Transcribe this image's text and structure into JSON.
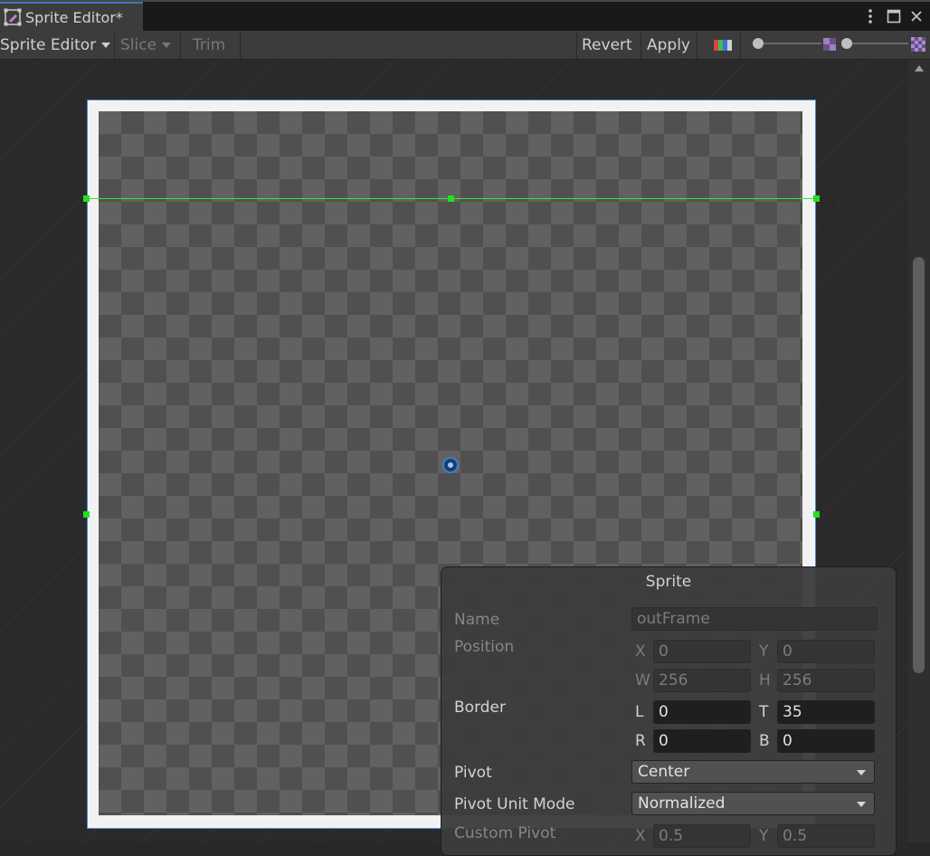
{
  "window": {
    "tab_title": "Sprite Editor*"
  },
  "toolbar": {
    "mode_label": "Sprite Editor",
    "slice_label": "Slice",
    "trim_label": "Trim",
    "revert_label": "Revert",
    "apply_label": "Apply",
    "zoom_slider_value": 0,
    "mip_slider_value": 0
  },
  "sprite_panel": {
    "title": "Sprite",
    "name_label": "Name",
    "name_value": "outFrame",
    "position_label": "Position",
    "x_label": "X",
    "x_value": "0",
    "y_label": "Y",
    "y_value": "0",
    "w_label": "W",
    "w_value": "256",
    "h_label": "H",
    "h_value": "256",
    "border_label": "Border",
    "l_label": "L",
    "l_value": "0",
    "t_label": "T",
    "t_value": "35",
    "r_label": "R",
    "r_value": "0",
    "b_label": "B",
    "b_value": "0",
    "pivot_label": "Pivot",
    "pivot_value": "Center",
    "pivot_unit_label": "Pivot Unit Mode",
    "pivot_unit_value": "Normalized",
    "custom_pivot_label": "Custom Pivot",
    "cp_x_label": "X",
    "cp_x_value": "0.5",
    "cp_y_label": "Y",
    "cp_y_value": "0.5"
  },
  "colors": {
    "accent": "#3a79bb",
    "border_handle": "#22e022",
    "pivot": "#3a7fd0"
  },
  "icons": {
    "tab": "sprite-editor-icon",
    "menu": "kebab-menu-icon",
    "maximize": "maximize-icon",
    "close": "close-icon",
    "color_channel": "rgb-channel-icon",
    "zoom_small": "checker-small-icon",
    "zoom_large": "checker-large-icon"
  }
}
